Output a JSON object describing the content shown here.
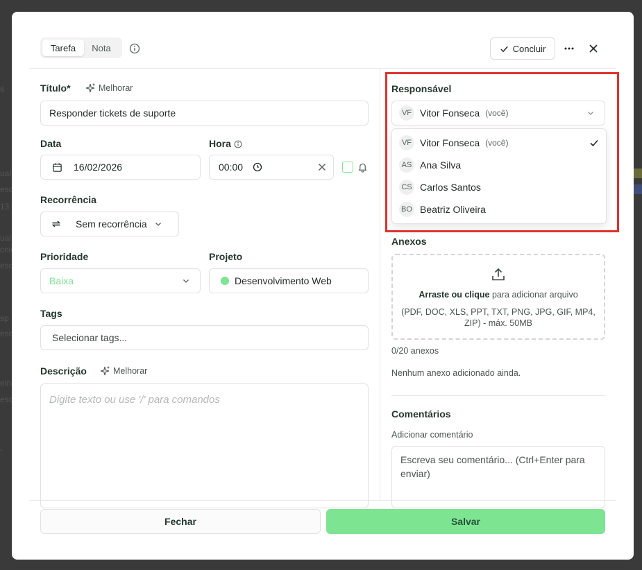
{
  "background": {
    "fragments": [
      "6",
      "ual",
      "esc",
      "13",
      "ual",
      "cnic",
      "esc",
      "sp",
      "esc",
      "eina",
      "esc",
      "-"
    ]
  },
  "header": {
    "tabs": [
      {
        "label": "Tarefa",
        "active": true
      },
      {
        "label": "Nota",
        "active": false
      }
    ],
    "concluir_label": "Concluir",
    "icons": {
      "info": "info-icon",
      "more": "more-icon",
      "close": "close-icon",
      "check": "check-icon"
    }
  },
  "form": {
    "title_label": "Título*",
    "improve_label": "Melhorar",
    "title_value": "Responder tickets de suporte",
    "date_label": "Data",
    "date_value": "16/02/2026",
    "time_label": "Hora",
    "time_value": "00:00",
    "recurrence_label": "Recorrência",
    "recurrence_value": "Sem recorrência",
    "priority_label": "Prioridade",
    "priority_value": "Baixa",
    "priority_color": "#7de491",
    "project_label": "Projeto",
    "project_value": "Desenvolvimento Web",
    "project_color": "#7de491",
    "tags_label": "Tags",
    "tags_placeholder": "Selecionar tags...",
    "description_label": "Descrição",
    "description_placeholder": "Digite texto ou use '/' para comandos"
  },
  "assignee": {
    "label": "Responsável",
    "selected": {
      "initials": "VF",
      "name": "Vitor Fonseca",
      "suffix": "(você)"
    },
    "options": [
      {
        "initials": "VF",
        "name": "Vitor Fonseca",
        "suffix": "(você)",
        "checked": true
      },
      {
        "initials": "AS",
        "name": "Ana Silva"
      },
      {
        "initials": "CS",
        "name": "Carlos Santos"
      },
      {
        "initials": "BO",
        "name": "Beatriz Oliveira"
      }
    ]
  },
  "attachments": {
    "label": "Anexos",
    "drop_bold": "Arraste ou clique",
    "drop_rest": "para adicionar arquivo",
    "formats": "(PDF, DOC, XLS, PPT, TXT, PNG, JPG, GIF, MP4, ZIP) - máx. 50MB",
    "count": "0/20 anexos",
    "empty": "Nenhum anexo adicionado ainda."
  },
  "comments": {
    "label": "Comentários",
    "add_label": "Adicionar comentário",
    "placeholder": "Escreva seu comentário... (Ctrl+Enter para enviar)"
  },
  "footer": {
    "close_label": "Fechar",
    "save_label": "Salvar"
  },
  "colors": {
    "accent": "#7de491",
    "highlight": "#e0312b"
  }
}
